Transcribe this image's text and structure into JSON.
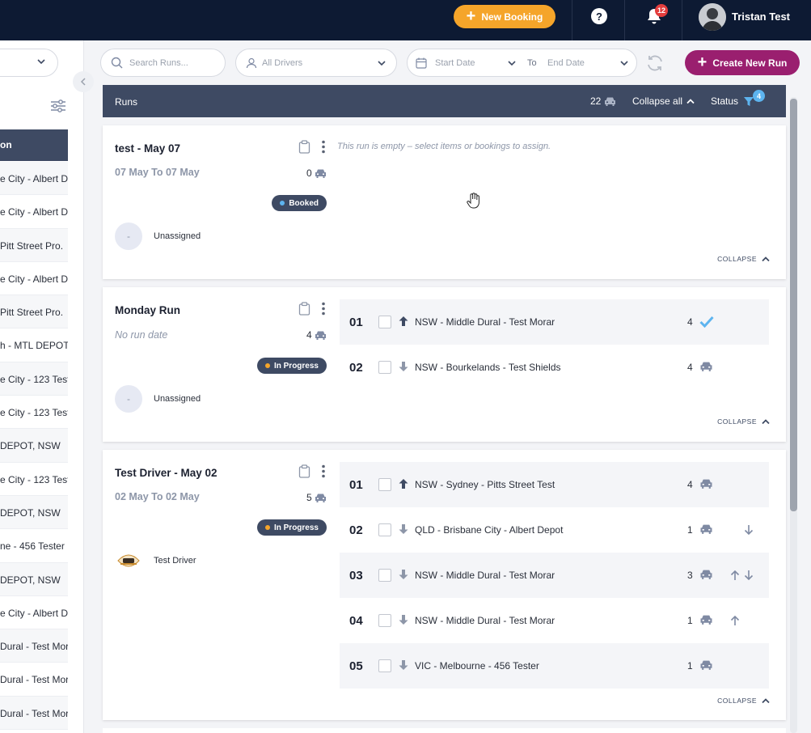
{
  "header": {
    "new_booking_label": "New Booking",
    "help_label": "?",
    "notifications_count": "12",
    "user_name": "Tristan Test"
  },
  "sidebar": {
    "header_label": "on",
    "items": [
      "e City - Albert D",
      "e City - Albert D",
      " Pitt Street Pro.",
      "e City - Albert D",
      " Pitt Street Pro.",
      "h - MTL DEPOT",
      "e City - 123 Test",
      "e City - 123 Test",
      "DEPOT, NSW",
      "e City - 123 Test",
      "DEPOT, NSW",
      "ne - 456 Tester",
      "DEPOT, NSW",
      "e City - Albert D",
      "Dural - Test Mora",
      "Dural - Test Mora",
      "Dural - Test Mora"
    ]
  },
  "filters": {
    "search_placeholder": "Search Runs...",
    "drivers_placeholder": "All Drivers",
    "start_date": "Start Date",
    "to_label": "To",
    "end_date": "End Date",
    "create_run_label": "Create New Run"
  },
  "runs_header": {
    "title": "Runs",
    "count": "22",
    "collapse_all": "Collapse all",
    "status": "Status",
    "status_filter_count": "4"
  },
  "runs": [
    {
      "title": "test - May 07",
      "date": "07 May To 07 May",
      "count": "0",
      "status": "Booked",
      "driver": "Unassigned",
      "driver_initial": "-",
      "empty_note": "This run is empty – select items or bookings to assign.",
      "collapse": "COLLAPSE"
    },
    {
      "title": "Monday Run",
      "date": "No run date",
      "count": "4",
      "status": "In Progress",
      "driver": "Unassigned",
      "driver_initial": "-",
      "collapse": "COLLAPSE",
      "stops": [
        {
          "num": "01",
          "addr": "NSW - Middle Dural - Test Morar",
          "qty": "4"
        },
        {
          "num": "02",
          "addr": "NSW - Bourkelands - Test Shields",
          "qty": "4"
        }
      ]
    },
    {
      "title": "Test Driver - May 02",
      "date": "02 May To 02 May",
      "count": "5",
      "status": "In Progress",
      "driver": "Test Driver",
      "collapse": "COLLAPSE",
      "stops": [
        {
          "num": "01",
          "addr": "NSW - Sydney - Pitts Street Test",
          "qty": "4"
        },
        {
          "num": "02",
          "addr": "QLD - Brisbane City - Albert Depot",
          "qty": "1"
        },
        {
          "num": "03",
          "addr": "NSW - Middle Dural - Test Morar",
          "qty": "3"
        },
        {
          "num": "04",
          "addr": "NSW - Middle Dural - Test Morar",
          "qty": "1"
        },
        {
          "num": "05",
          "addr": "VIC - Melbourne - 456 Tester",
          "qty": "1"
        }
      ]
    }
  ],
  "colors": {
    "topbar": "#0d1a33",
    "accent_orange": "#f5a52a",
    "accent_purple": "#9a1f6f",
    "panel_header": "#3e4a63",
    "booked_dot": "#5db4ef",
    "in_progress_dot": "#f5a52a"
  }
}
